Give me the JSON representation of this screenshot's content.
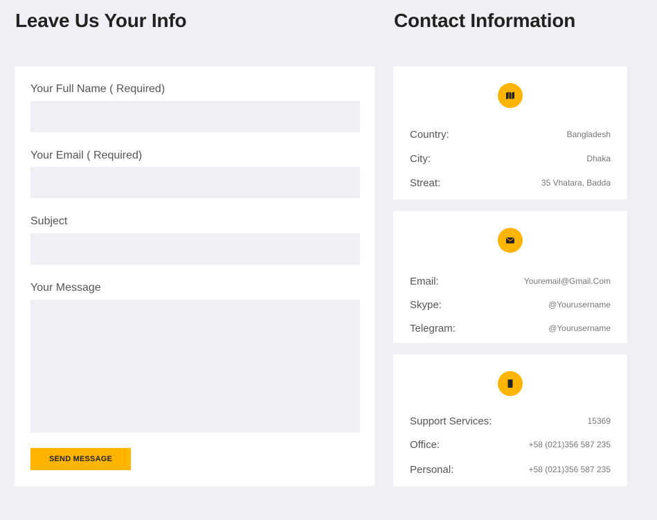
{
  "form": {
    "heading": "Leave Us Your Info",
    "full_name_label": "Your Full Name ( Required)",
    "email_label": "Your Email ( Required)",
    "subject_label": "Subject",
    "message_label": "Your Message",
    "full_name_value": "",
    "email_value": "",
    "subject_value": "",
    "message_value": "",
    "send_label": "SEND MESSAGE"
  },
  "contact": {
    "heading": "Contact Information",
    "cards": [
      {
        "icon": "map-icon",
        "rows": [
          {
            "label": "Country:",
            "value": "Bangladesh"
          },
          {
            "label": "City:",
            "value": "Dhaka"
          },
          {
            "label": "Streat:",
            "value": "35 Vhatara, Badda"
          }
        ]
      },
      {
        "icon": "envelope-icon",
        "rows": [
          {
            "label": "Email:",
            "value": "Youremail@Gmail.Com"
          },
          {
            "label": "Skype:",
            "value": "@Yourusername"
          },
          {
            "label": "Telegram:",
            "value": "@Yourusername"
          }
        ]
      },
      {
        "icon": "phone-icon",
        "rows": [
          {
            "label": "Support Services:",
            "value": "15369"
          },
          {
            "label": "Office:",
            "value": "+58 (021)356 587 235"
          },
          {
            "label": "Personal:",
            "value": "+58 (021)356 587 235"
          }
        ]
      }
    ]
  },
  "colors": {
    "background": "#efeff5",
    "panel": "#ffffff",
    "accent": "#ffb400",
    "heading": "#222222"
  }
}
